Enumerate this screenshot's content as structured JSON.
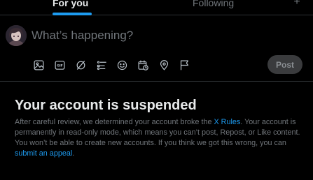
{
  "tabs": {
    "for_you": "For you",
    "following": "Following",
    "add": "+"
  },
  "composer": {
    "placeholder": "What’s happening?",
    "post_label": "Post",
    "tools": [
      "image-icon",
      "gif-icon",
      "grok-icon",
      "poll-icon",
      "emoji-icon",
      "schedule-icon",
      "location-icon",
      "flag-icon"
    ]
  },
  "notice": {
    "title": "Your account is suspended",
    "text_1": "After careful review, we determined your account broke the ",
    "rules_link": "X Rules",
    "text_2": ". Your account is permanently in read-only mode, which means you can’t post, Repost, or Like content. You won’t be able to create new accounts. If you think we got this wrong, you can ",
    "appeal_link": "submit an appeal",
    "text_3": "."
  },
  "colors": {
    "background": "#000000",
    "accent": "#1d9bf0",
    "text": "#e7e9ea",
    "muted": "#71767b",
    "border": "#2f3336"
  }
}
